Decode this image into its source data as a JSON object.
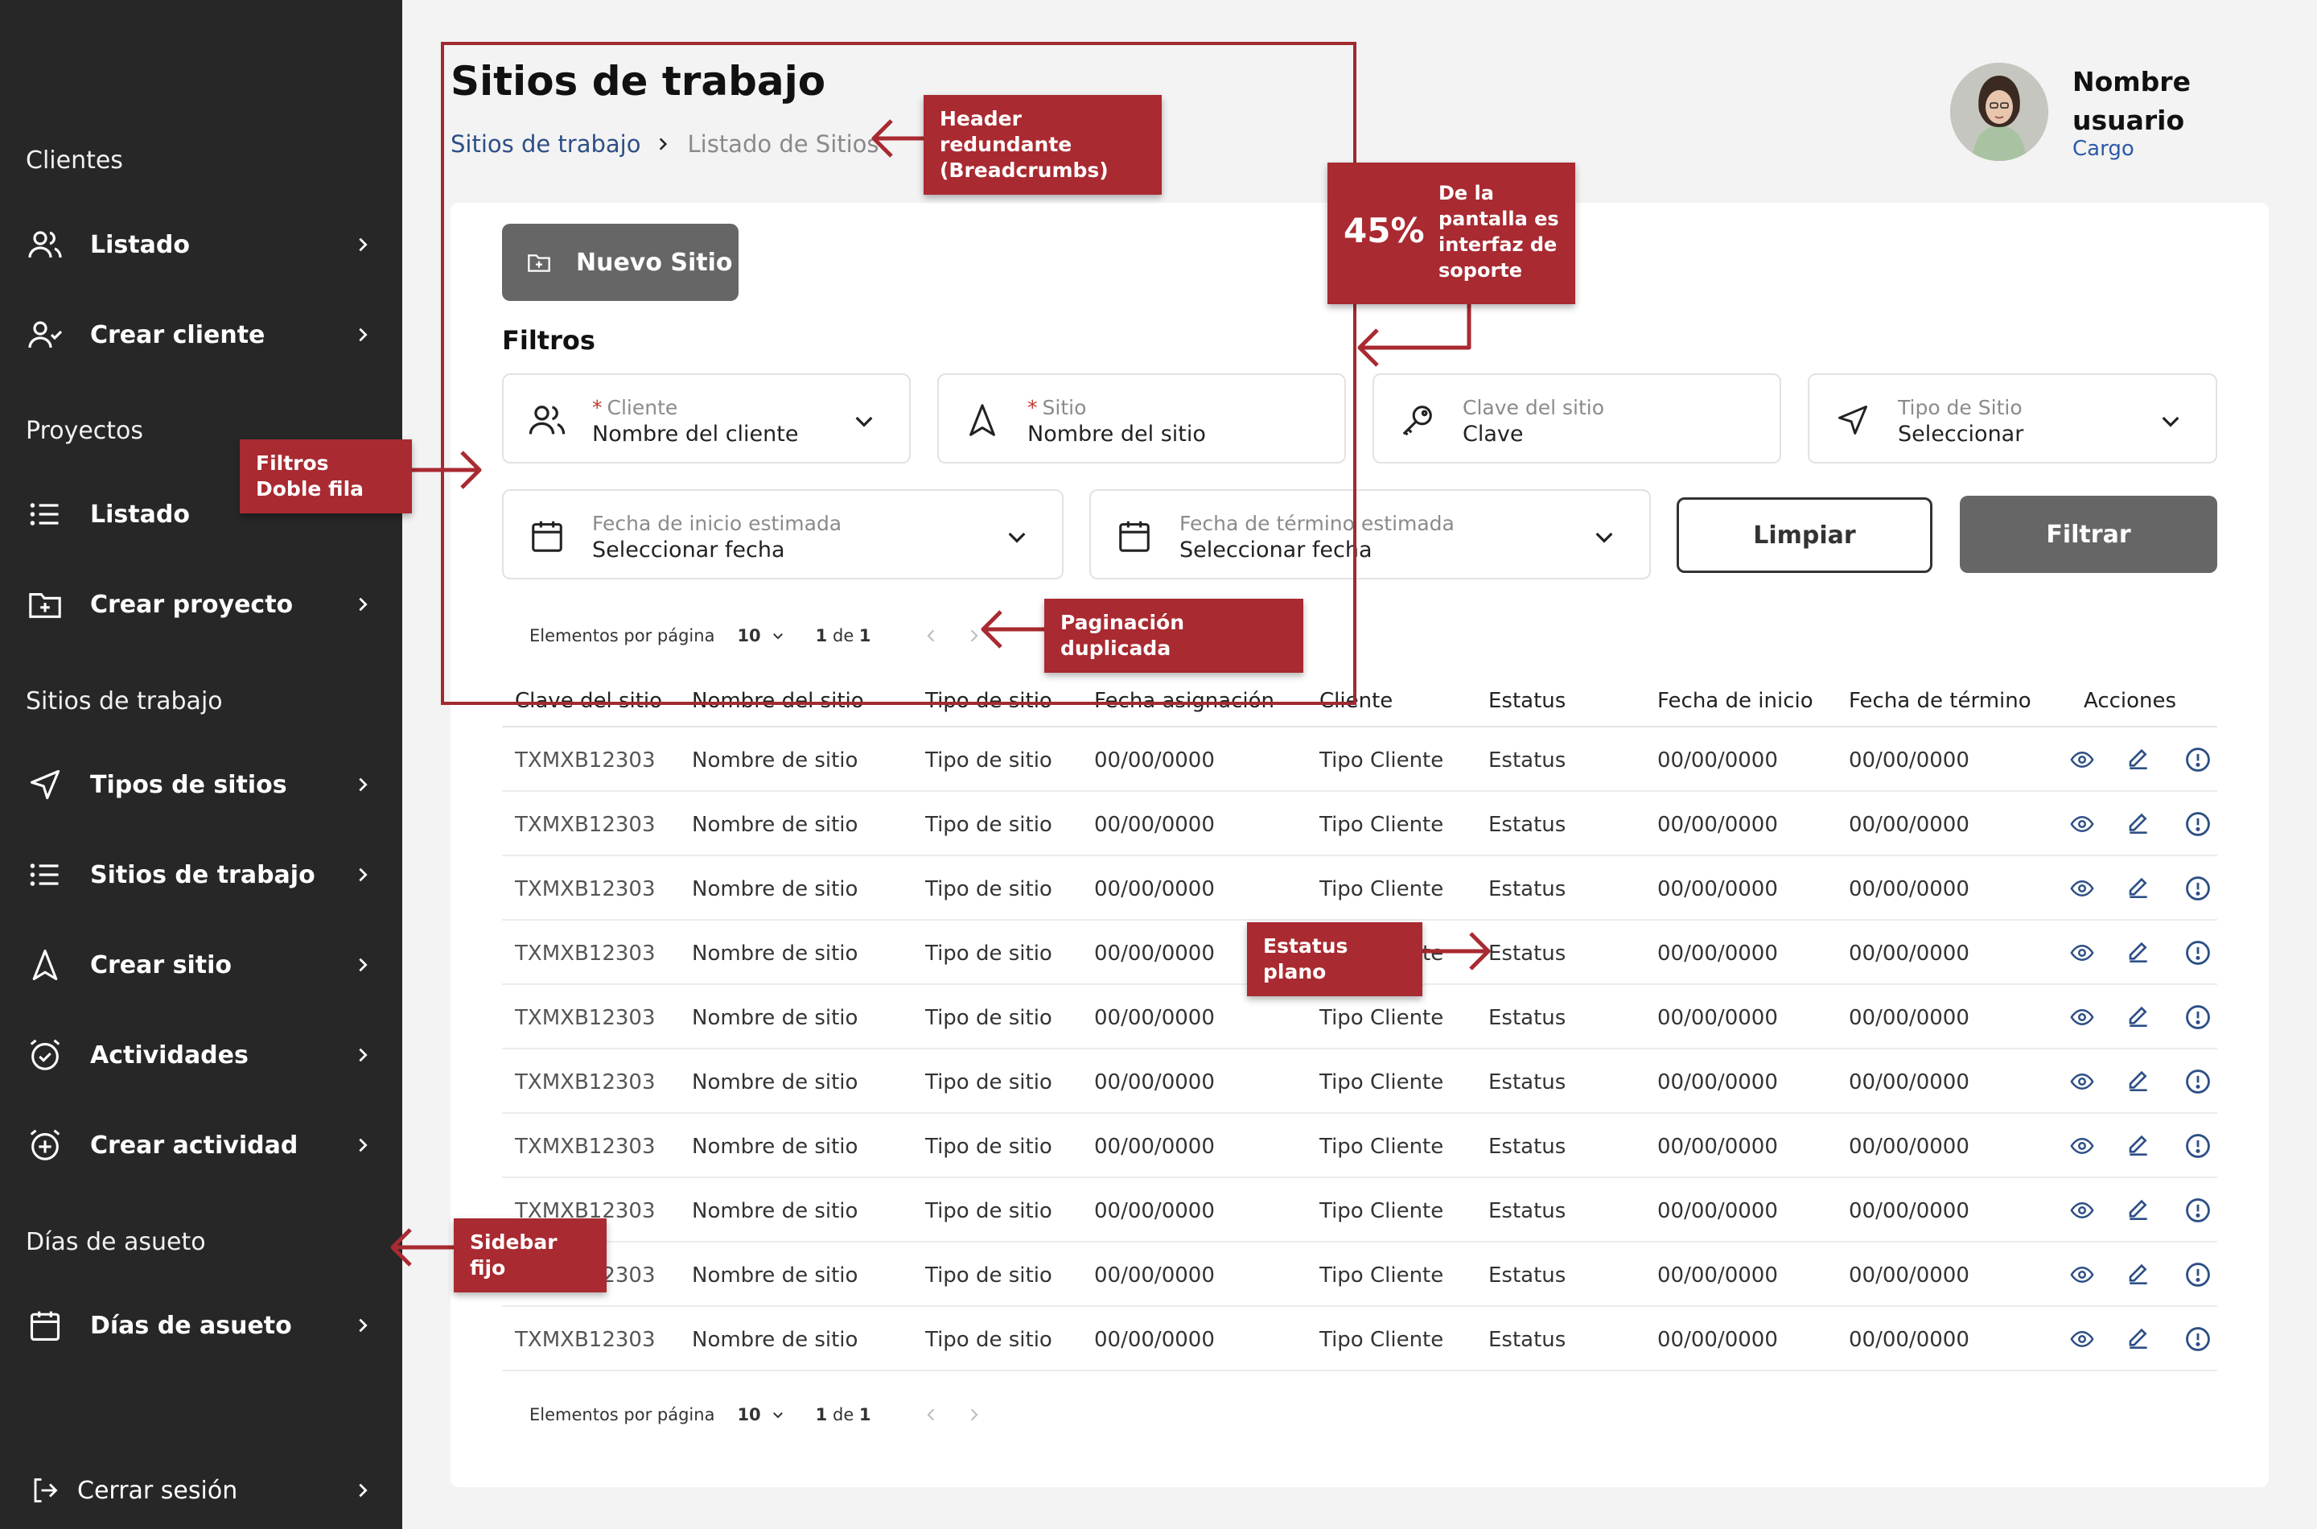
{
  "sidebar": {
    "sections": [
      "Clientes",
      "Proyectos",
      "Sitios de trabajo",
      "Días de asueto"
    ],
    "items": [
      {
        "label": "Listado",
        "icon": "users-icon"
      },
      {
        "label": "Crear cliente",
        "icon": "user-check-icon"
      },
      {
        "label": "Listado",
        "icon": "list-icon"
      },
      {
        "label": "Crear proyecto",
        "icon": "folder-plus-icon"
      },
      {
        "label": "Tipos de sitios",
        "icon": "navigation-icon"
      },
      {
        "label": "Sitios de trabajo",
        "icon": "list-icon"
      },
      {
        "label": "Crear sitio",
        "icon": "navigation-up-icon"
      },
      {
        "label": "Actividades",
        "icon": "alarm-check-icon"
      },
      {
        "label": "Crear actividad",
        "icon": "alarm-plus-icon"
      },
      {
        "label": "Días de asueto",
        "icon": "calendar-icon"
      }
    ],
    "logout": "Cerrar sesión"
  },
  "header": {
    "title": "Sitios de trabajo",
    "breadcrumb": {
      "link": "Sitios de trabajo",
      "current": "Listado de Sitios"
    }
  },
  "user": {
    "name": "Nombre usuario",
    "role": "Cargo"
  },
  "toolbar": {
    "new_label": "Nuevo Sitio"
  },
  "filters": {
    "title": "Filtros",
    "cliente": {
      "label": "Cliente",
      "value": "Nombre del cliente",
      "required": "*"
    },
    "sitio": {
      "label": "Sitio",
      "value": "Nombre del sitio",
      "required": "*"
    },
    "clave": {
      "label": "Clave del sitio",
      "value": "Clave"
    },
    "tipo": {
      "label": "Tipo de Sitio",
      "value": "Seleccionar"
    },
    "fecha_inicio": {
      "label": "Fecha de inicio estimada",
      "value": "Seleccionar fecha"
    },
    "fecha_termino": {
      "label": "Fecha de término estimada",
      "value": "Seleccionar fecha"
    },
    "clear_label": "Limpiar",
    "filter_label": "Filtrar"
  },
  "pagination": {
    "per_page_label": "Elementos por página",
    "per_page": "10",
    "current": "1",
    "of": "de",
    "total": "1"
  },
  "table": {
    "columns": [
      "Clave del sitio",
      "Nombre del sitio",
      "Tipo de sitio",
      "Fecha asignación",
      "Cliente",
      "Estatus",
      "Fecha de inicio",
      "Fecha de término",
      "Acciones"
    ],
    "rows": [
      [
        "TXMXB12303",
        "Nombre de sitio",
        "Tipo de sitio",
        "00/00/0000",
        "Tipo Cliente",
        "Estatus",
        "00/00/0000",
        "00/00/0000"
      ],
      [
        "TXMXB12303",
        "Nombre de sitio",
        "Tipo de sitio",
        "00/00/0000",
        "Tipo Cliente",
        "Estatus",
        "00/00/0000",
        "00/00/0000"
      ],
      [
        "TXMXB12303",
        "Nombre de sitio",
        "Tipo de sitio",
        "00/00/0000",
        "Tipo Cliente",
        "Estatus",
        "00/00/0000",
        "00/00/0000"
      ],
      [
        "TXMXB12303",
        "Nombre de sitio",
        "Tipo de sitio",
        "00/00/0000",
        "Tipo Cliente",
        "Estatus",
        "00/00/0000",
        "00/00/0000"
      ],
      [
        "TXMXB12303",
        "Nombre de sitio",
        "Tipo de sitio",
        "00/00/0000",
        "Tipo Cliente",
        "Estatus",
        "00/00/0000",
        "00/00/0000"
      ],
      [
        "TXMXB12303",
        "Nombre de sitio",
        "Tipo de sitio",
        "00/00/0000",
        "Tipo Cliente",
        "Estatus",
        "00/00/0000",
        "00/00/0000"
      ],
      [
        "TXMXB12303",
        "Nombre de sitio",
        "Tipo de sitio",
        "00/00/0000",
        "Tipo Cliente",
        "Estatus",
        "00/00/0000",
        "00/00/0000"
      ],
      [
        "TXMXB12303",
        "Nombre de sitio",
        "Tipo de sitio",
        "00/00/0000",
        "Tipo Cliente",
        "Estatus",
        "00/00/0000",
        "00/00/0000"
      ],
      [
        "TXMXB12303",
        "Nombre de sitio",
        "Tipo de sitio",
        "00/00/0000",
        "Tipo Cliente",
        "Estatus",
        "00/00/0000",
        "00/00/0000"
      ],
      [
        "TXMXB12303",
        "Nombre de sitio",
        "Tipo de sitio",
        "00/00/0000",
        "Tipo Cliente",
        "Estatus",
        "00/00/0000",
        "00/00/0000"
      ]
    ],
    "action_icons": [
      "eye-icon",
      "edit-icon",
      "alert-circle-icon"
    ]
  },
  "annotations": {
    "header": "Header redundante (Breadcrumbs)",
    "percent": "45%",
    "percent_text": "De la pantalla es interfaz de soporte",
    "filters": "Filtros Doble fila",
    "pagination": "Paginación duplicada",
    "status": "Estatus plano",
    "sidebar": "Sidebar fijo"
  },
  "colors": {
    "sidebar_bg": "#272727",
    "accent_blue": "#2d4f86",
    "annotation_red": "#a92a31",
    "button_gray": "#666666"
  }
}
